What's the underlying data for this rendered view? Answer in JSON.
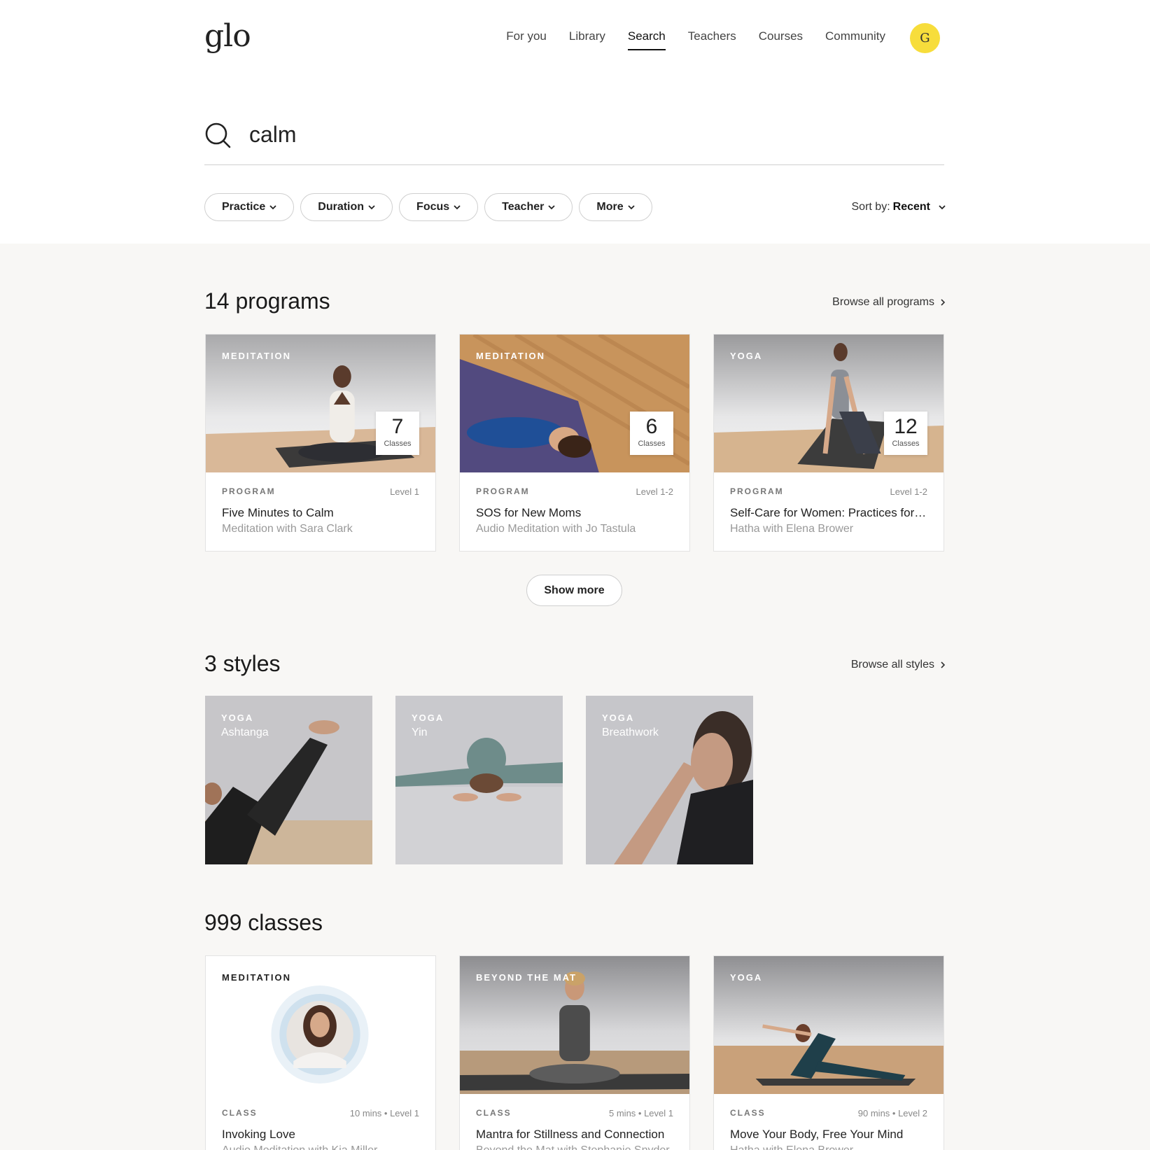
{
  "header": {
    "logo": "glo",
    "nav": [
      "For you",
      "Library",
      "Search",
      "Teachers",
      "Courses",
      "Community"
    ],
    "active_nav": "Search",
    "avatar_initial": "G",
    "avatar_color": "#f7dd3b"
  },
  "search": {
    "value": "calm",
    "icon": "search-icon"
  },
  "filters": [
    "Practice",
    "Duration",
    "Focus",
    "Teacher",
    "More"
  ],
  "sort": {
    "label": "Sort by:",
    "value": "Recent"
  },
  "programs": {
    "heading": "14 programs",
    "browse": "Browse all programs",
    "show_more": "Show more",
    "items": [
      {
        "tag": "MEDITATION",
        "count": "7",
        "count_label": "Classes",
        "kind": "PROGRAM",
        "level": "Level 1",
        "title": "Five Minutes to Calm",
        "subtitle": "Meditation with Sara Clark"
      },
      {
        "tag": "MEDITATION",
        "count": "6",
        "count_label": "Classes",
        "kind": "PROGRAM",
        "level": "Level 1-2",
        "title": "SOS for New Moms",
        "subtitle": "Audio Meditation with Jo Tastula"
      },
      {
        "tag": "YOGA",
        "count": "12",
        "count_label": "Classes",
        "kind": "PROGRAM",
        "level": "Level 1-2",
        "title": "Self-Care for Women: Practices for ...",
        "subtitle": "Hatha with Elena Brower"
      }
    ]
  },
  "styles": {
    "heading": "3 styles",
    "browse": "Browse all styles",
    "items": [
      {
        "tag": "YOGA",
        "name": "Ashtanga"
      },
      {
        "tag": "YOGA",
        "name": "Yin"
      },
      {
        "tag": "YOGA",
        "name": "Breathwork"
      }
    ]
  },
  "classes": {
    "heading": "999 classes",
    "items": [
      {
        "tag": "MEDITATION",
        "kind": "CLASS",
        "level": "10 mins • Level 1",
        "title": "Invoking Love",
        "subtitle": "Audio Meditation with Kia Miller"
      },
      {
        "tag": "BEYOND THE MAT",
        "kind": "CLASS",
        "level": "5 mins • Level 1",
        "title": "Mantra for Stillness and Connection",
        "subtitle": "Beyond the Mat with Stephanie Snyder"
      },
      {
        "tag": "YOGA",
        "kind": "CLASS",
        "level": "90 mins • Level 2",
        "title": "Move Your Body, Free Your Mind",
        "subtitle": "Hatha with Elena Brower"
      }
    ]
  }
}
